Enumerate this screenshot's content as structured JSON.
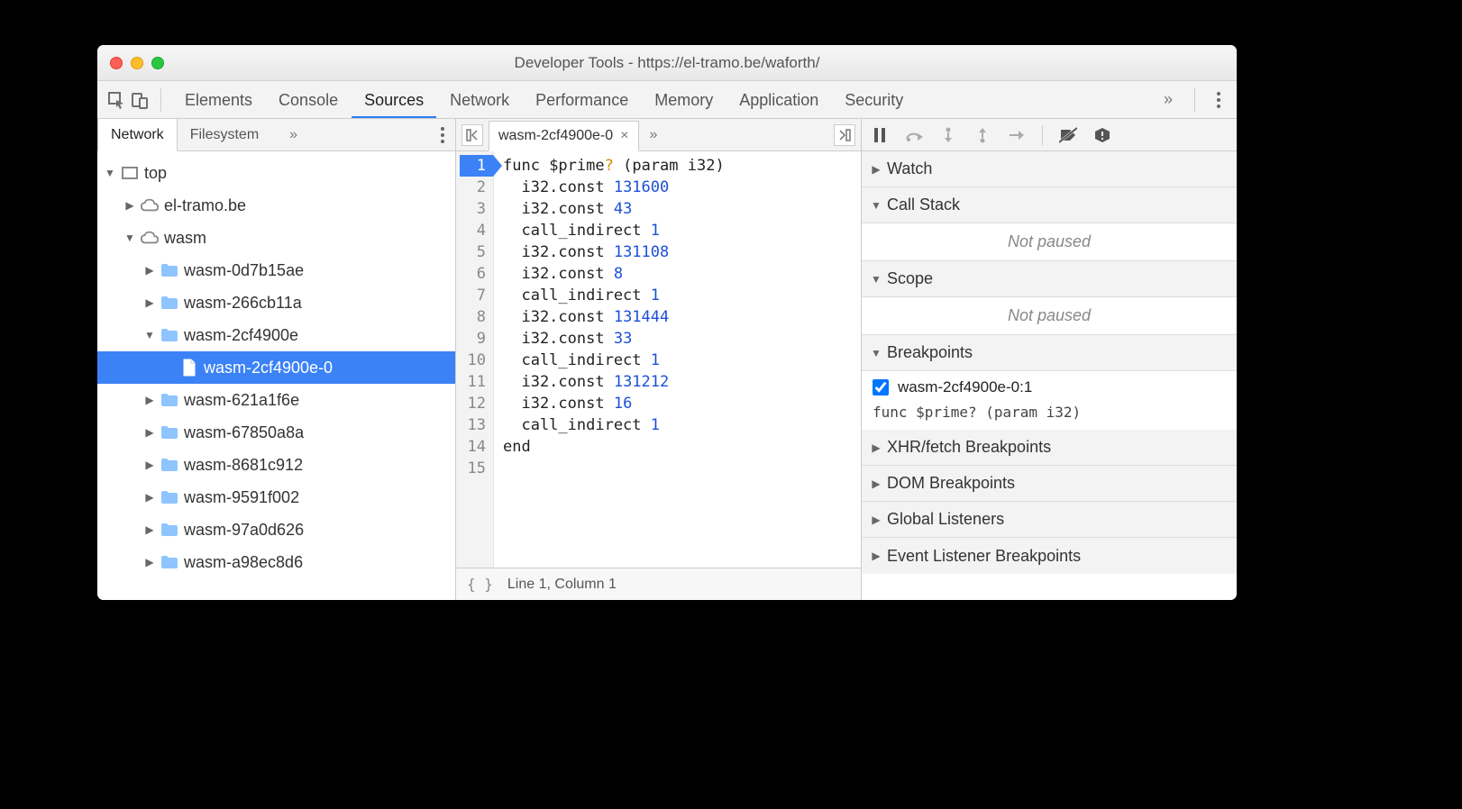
{
  "window": {
    "title": "Developer Tools - https://el-tramo.be/waforth/"
  },
  "tabs": {
    "items": [
      "Elements",
      "Console",
      "Sources",
      "Network",
      "Performance",
      "Memory",
      "Application",
      "Security"
    ],
    "active": "Sources",
    "overflow": "»"
  },
  "leftPanel": {
    "tabs": [
      "Network",
      "Filesystem"
    ],
    "tabsOverflow": "»",
    "activeTab": "Network",
    "tree": {
      "top": "top",
      "domain": "el-tramo.be",
      "wasm": "wasm",
      "items": [
        "wasm-0d7b15ae",
        "wasm-266cb11a",
        "wasm-2cf4900e",
        "wasm-621a1f6e",
        "wasm-67850a8a",
        "wasm-8681c912",
        "wasm-9591f002",
        "wasm-97a0d626",
        "wasm-a98ec8d6"
      ],
      "expandedIndex": 2,
      "selectedFile": "wasm-2cf4900e-0"
    }
  },
  "editor": {
    "fileTab": "wasm-2cf4900e-0",
    "overflow": "»",
    "lines": [
      {
        "n": 1,
        "bp": true,
        "indent": 0,
        "tokens": [
          {
            "t": "func ",
            "c": ""
          },
          {
            "t": "$prime",
            "c": "fn"
          },
          {
            "t": "?",
            "c": "q"
          },
          {
            "t": " (param i32)",
            "c": ""
          }
        ]
      },
      {
        "n": 2,
        "bp": false,
        "indent": 1,
        "tokens": [
          {
            "t": "i32.const ",
            "c": ""
          },
          {
            "t": "131600",
            "c": "num"
          }
        ]
      },
      {
        "n": 3,
        "bp": false,
        "indent": 1,
        "tokens": [
          {
            "t": "i32.const ",
            "c": ""
          },
          {
            "t": "43",
            "c": "num"
          }
        ]
      },
      {
        "n": 4,
        "bp": false,
        "indent": 1,
        "tokens": [
          {
            "t": "call_indirect ",
            "c": ""
          },
          {
            "t": "1",
            "c": "num"
          }
        ]
      },
      {
        "n": 5,
        "bp": false,
        "indent": 1,
        "tokens": [
          {
            "t": "i32.const ",
            "c": ""
          },
          {
            "t": "131108",
            "c": "num"
          }
        ]
      },
      {
        "n": 6,
        "bp": false,
        "indent": 1,
        "tokens": [
          {
            "t": "i32.const ",
            "c": ""
          },
          {
            "t": "8",
            "c": "num"
          }
        ]
      },
      {
        "n": 7,
        "bp": false,
        "indent": 1,
        "tokens": [
          {
            "t": "call_indirect ",
            "c": ""
          },
          {
            "t": "1",
            "c": "num"
          }
        ]
      },
      {
        "n": 8,
        "bp": false,
        "indent": 1,
        "tokens": [
          {
            "t": "i32.const ",
            "c": ""
          },
          {
            "t": "131444",
            "c": "num"
          }
        ]
      },
      {
        "n": 9,
        "bp": false,
        "indent": 1,
        "tokens": [
          {
            "t": "i32.const ",
            "c": ""
          },
          {
            "t": "33",
            "c": "num"
          }
        ]
      },
      {
        "n": 10,
        "bp": false,
        "indent": 1,
        "tokens": [
          {
            "t": "call_indirect ",
            "c": ""
          },
          {
            "t": "1",
            "c": "num"
          }
        ]
      },
      {
        "n": 11,
        "bp": false,
        "indent": 1,
        "tokens": [
          {
            "t": "i32.const ",
            "c": ""
          },
          {
            "t": "131212",
            "c": "num"
          }
        ]
      },
      {
        "n": 12,
        "bp": false,
        "indent": 1,
        "tokens": [
          {
            "t": "i32.const ",
            "c": ""
          },
          {
            "t": "16",
            "c": "num"
          }
        ]
      },
      {
        "n": 13,
        "bp": false,
        "indent": 1,
        "tokens": [
          {
            "t": "call_indirect ",
            "c": ""
          },
          {
            "t": "1",
            "c": "num"
          }
        ]
      },
      {
        "n": 14,
        "bp": false,
        "indent": 0,
        "tokens": [
          {
            "t": "end",
            "c": ""
          }
        ]
      },
      {
        "n": 15,
        "bp": false,
        "indent": 0,
        "tokens": []
      }
    ],
    "status": "Line 1, Column 1",
    "prettyPrint": "{ }"
  },
  "debugger": {
    "sections": {
      "watch": {
        "label": "Watch",
        "expanded": false
      },
      "callstack": {
        "label": "Call Stack",
        "expanded": true,
        "body": "Not paused"
      },
      "scope": {
        "label": "Scope",
        "expanded": true,
        "body": "Not paused"
      },
      "breakpoints": {
        "label": "Breakpoints",
        "expanded": true,
        "items": [
          {
            "checked": true,
            "label": "wasm-2cf4900e-0:1",
            "sub": "func $prime? (param i32)"
          }
        ]
      },
      "xhr": {
        "label": "XHR/fetch Breakpoints",
        "expanded": false
      },
      "dom": {
        "label": "DOM Breakpoints",
        "expanded": false
      },
      "global": {
        "label": "Global Listeners",
        "expanded": false
      },
      "event": {
        "label": "Event Listener Breakpoints",
        "expanded": false
      }
    }
  }
}
